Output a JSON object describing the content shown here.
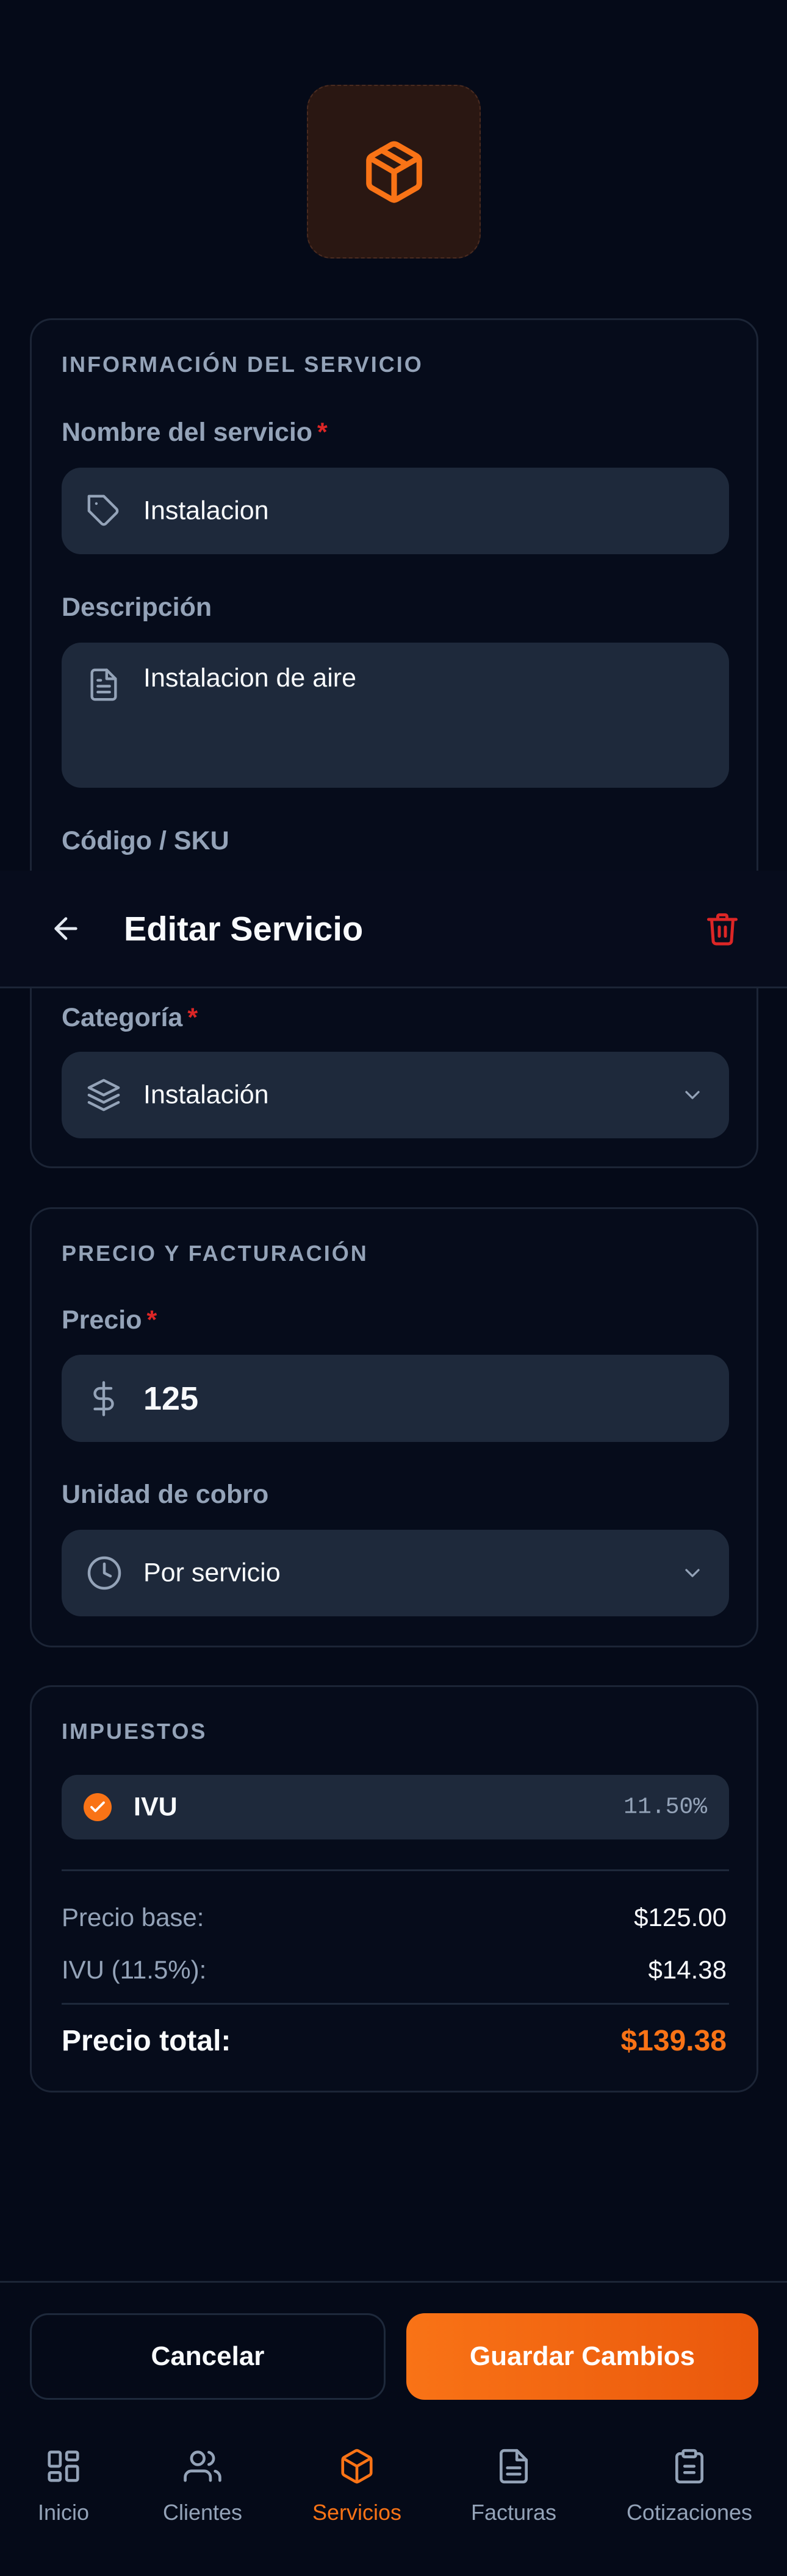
{
  "header": {
    "title": "Editar Servicio"
  },
  "service_info": {
    "section_title": "INFORMACIÓN DEL SERVICIO",
    "name_label": "Nombre del servicio",
    "name_value": "Instalacion",
    "description_label": "Descripción",
    "description_value": "Instalacion de aire",
    "sku_label": "Código / SKU",
    "category_label": "Categoría",
    "category_value": "Instalación",
    "required_mark": "*"
  },
  "pricing": {
    "section_title": "PRECIO Y FACTURACIÓN",
    "price_label": "Precio",
    "price_value": "125",
    "unit_label": "Unidad de cobro",
    "unit_value": "Por servicio",
    "required_mark": "*"
  },
  "taxes": {
    "section_title": "IMPUESTOS",
    "tax_name": "IVU",
    "tax_rate": "11.50%",
    "tax_checked": true,
    "base_label": "Precio base:",
    "base_value": "$125.00",
    "tax_line_label": "IVU (11.5%):",
    "tax_line_value": "$14.38",
    "total_label": "Precio total:",
    "total_value": "$139.38"
  },
  "footer": {
    "cancel_label": "Cancelar",
    "save_label": "Guardar Cambios"
  },
  "nav": {
    "items": [
      {
        "label": "Inicio",
        "icon": "grid-icon",
        "active": false
      },
      {
        "label": "Clientes",
        "icon": "users-icon",
        "active": false
      },
      {
        "label": "Servicios",
        "icon": "package-icon",
        "active": true
      },
      {
        "label": "Facturas",
        "icon": "file-icon",
        "active": false
      },
      {
        "label": "Cotizaciones",
        "icon": "clipboard-icon",
        "active": false
      }
    ]
  },
  "colors": {
    "accent": "#f97316",
    "background": "#050a18",
    "field": "#1e293b",
    "danger": "#dc2626"
  }
}
